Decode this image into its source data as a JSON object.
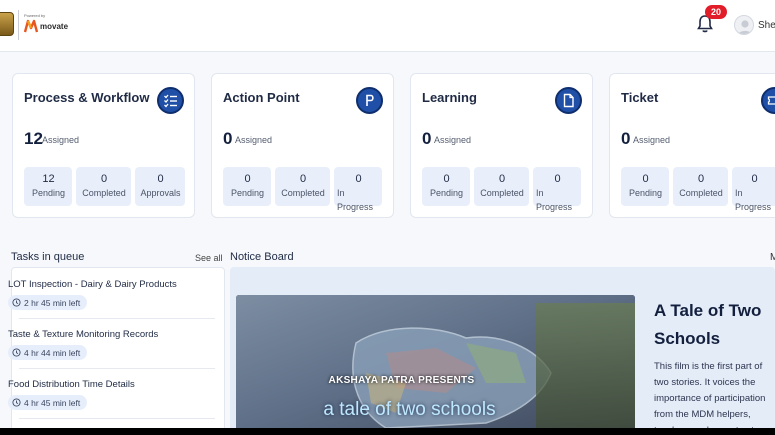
{
  "header": {
    "brand_prefix": "Powered by",
    "brand_name": "movate",
    "notifications_count": "20",
    "user_name": "She"
  },
  "cards": [
    {
      "title": "Process & Workflow",
      "icon": "checklist-icon",
      "count": "12",
      "count_label": "Assigned",
      "stats": [
        {
          "value": "12",
          "label": "Pending"
        },
        {
          "value": "0",
          "label": "Completed"
        },
        {
          "value": "0",
          "label": "Approvals"
        }
      ]
    },
    {
      "title": "Action Point",
      "icon": "letter-p-icon",
      "count": "0",
      "count_label": "Assigned",
      "stats": [
        {
          "value": "0",
          "label": "Pending"
        },
        {
          "value": "0",
          "label": "Completed"
        },
        {
          "value": "0",
          "label_line1": "In",
          "label_line2": "Progress"
        }
      ]
    },
    {
      "title": "Learning",
      "icon": "document-icon",
      "count": "0",
      "count_label": "Assigned",
      "stats": [
        {
          "value": "0",
          "label": "Pending"
        },
        {
          "value": "0",
          "label": "Completed"
        },
        {
          "value": "0",
          "label_line1": "In",
          "label_line2": "Progress"
        }
      ]
    },
    {
      "title": "Ticket",
      "icon": "ticket-icon",
      "count": "0",
      "count_label": "Assigned",
      "stats": [
        {
          "value": "0",
          "label": "Pending"
        },
        {
          "value": "0",
          "label": "Completed"
        },
        {
          "value": "0",
          "label_line1": "In",
          "label_line2": "Progress"
        }
      ]
    }
  ],
  "tasks": {
    "title": "Tasks in queue",
    "see_all": "See all",
    "items": [
      {
        "title": "LOT Inspection - Dairy & Dairy Products",
        "time_left": "2 hr 45 min left"
      },
      {
        "title": "Taste & Texture Monitoring Records",
        "time_left": "4 hr 44 min left"
      },
      {
        "title": "Food Distribution Time Details",
        "time_left": "4 hr 45 min left"
      }
    ]
  },
  "notice": {
    "title": "Notice Board",
    "more": "M",
    "video_caption_1": "AKSHAYA PATRA PRESENTS",
    "video_caption_2": "a tale of two schools",
    "story_title": "A Tale of Two Schools",
    "story_lines": [
      "This film is the first part of",
      "two stories. It voices the",
      "importance of participation",
      "from the MDM helpers,",
      "teachers and parents at"
    ]
  },
  "colors": {
    "accent": "#1f4fa6",
    "badge": "#e11d2a",
    "stat_bg": "#e9effa",
    "notice_bg": "#e4ecf8"
  }
}
